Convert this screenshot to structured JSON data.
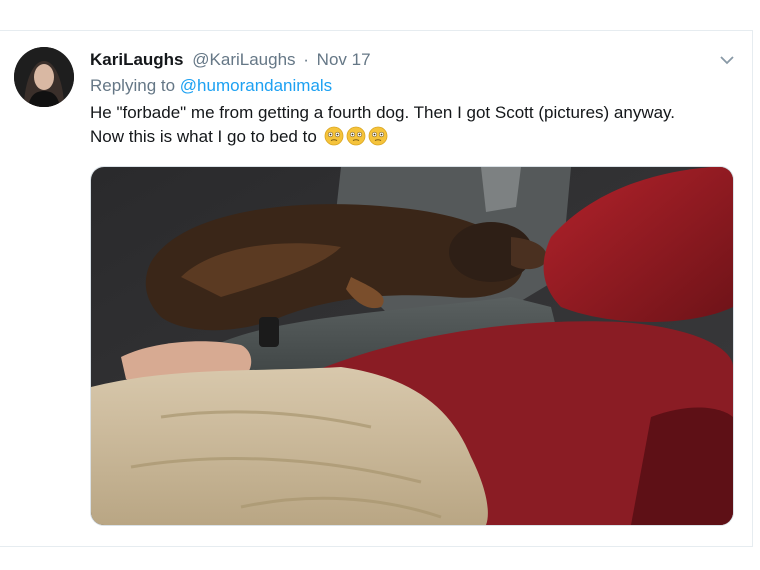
{
  "tweet": {
    "display_name": "KariLaughs",
    "handle": "@KariLaughs",
    "separator": "·",
    "date": "Nov 17",
    "replying_prefix": "Replying to",
    "replying_to": "@humorandanimals",
    "text": "He \"forbade\" me from getting a fourth dog. Then I got Scott (pictures) anyway. Now this is what I go to bed to",
    "emojis": [
      "flushed-face-icon",
      "flushed-face-icon",
      "flushed-face-icon"
    ],
    "media": {
      "image_icon": "sleeping-dog-photo"
    },
    "menu_icon": "chevron-down-icon"
  },
  "colors": {
    "link": "#1da1f2",
    "secondary_text": "#657786",
    "primary_text": "#14171a"
  }
}
